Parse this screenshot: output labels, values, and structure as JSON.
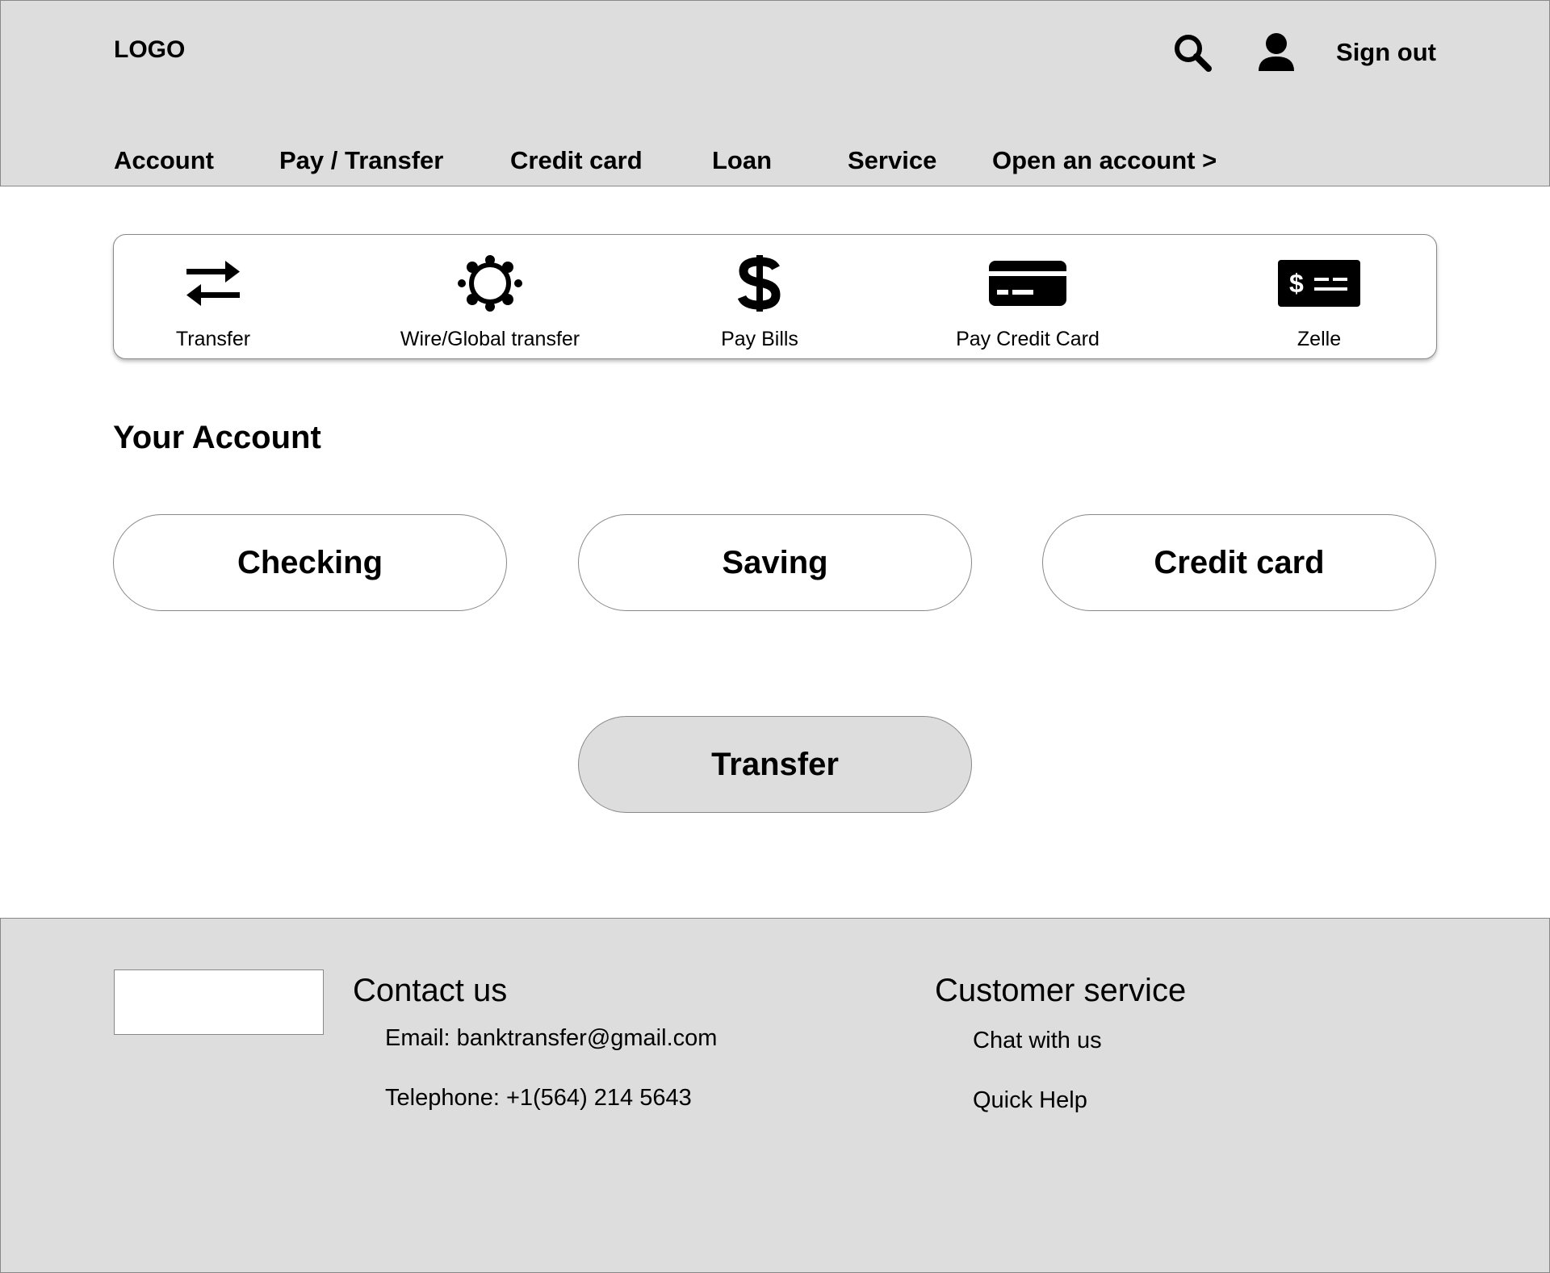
{
  "header": {
    "logo": "LOGO",
    "search_icon": "search-icon",
    "user_icon": "user-icon",
    "signout_label": "Sign out"
  },
  "nav": {
    "items": [
      {
        "label": "Account"
      },
      {
        "label": "Pay / Transfer"
      },
      {
        "label": "Credit card"
      },
      {
        "label": "Loan"
      },
      {
        "label": "Service"
      },
      {
        "label": "Open an account >"
      }
    ]
  },
  "quick_actions": {
    "items": [
      {
        "label": "Transfer",
        "icon": "transfer-arrows-icon"
      },
      {
        "label": "Wire/Global transfer",
        "icon": "global-network-icon"
      },
      {
        "label": "Pay Bills",
        "icon": "dollar-icon"
      },
      {
        "label": "Pay Credit Card",
        "icon": "credit-card-icon"
      },
      {
        "label": "Zelle",
        "icon": "check-dollar-icon"
      }
    ]
  },
  "accounts": {
    "title": "Your Account",
    "buttons": [
      {
        "label": "Checking"
      },
      {
        "label": "Saving"
      },
      {
        "label": "Credit card"
      }
    ],
    "transfer_label": "Transfer"
  },
  "footer": {
    "contact": {
      "heading": "Contact us",
      "email": "Email: banktransfer@gmail.com",
      "telephone": "Telephone: +1(564) 214 5643"
    },
    "customer_service": {
      "heading": "Customer service",
      "links": [
        {
          "label": "Chat with us"
        },
        {
          "label": "Quick Help"
        }
      ]
    }
  },
  "colors": {
    "header_bg": "#dddddd",
    "footer_bg": "#dddddd",
    "border": "#888888",
    "text": "#000000"
  }
}
